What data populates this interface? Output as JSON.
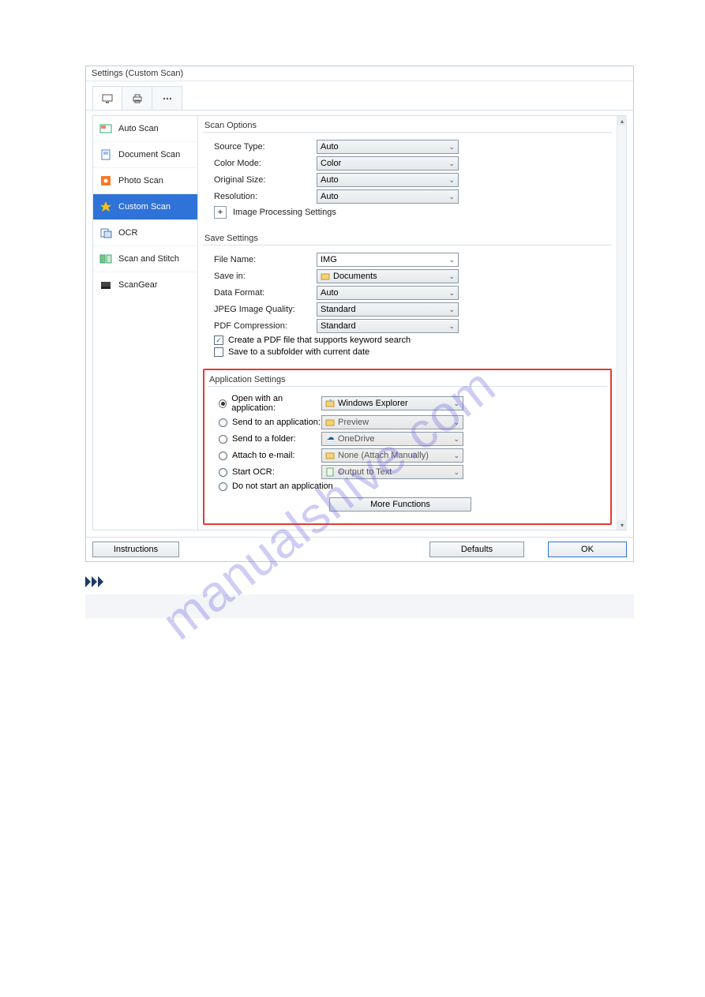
{
  "window": {
    "title": "Settings (Custom Scan)"
  },
  "sidebar": {
    "items": [
      {
        "label": "Auto Scan"
      },
      {
        "label": "Document Scan"
      },
      {
        "label": "Photo Scan"
      },
      {
        "label": "Custom Scan"
      },
      {
        "label": "OCR"
      },
      {
        "label": "Scan and Stitch"
      },
      {
        "label": "ScanGear"
      }
    ]
  },
  "scan_options": {
    "title": "Scan Options",
    "source_type": {
      "label": "Source Type:",
      "value": "Auto"
    },
    "color_mode": {
      "label": "Color Mode:",
      "value": "Color"
    },
    "original_size": {
      "label": "Original Size:",
      "value": "Auto"
    },
    "resolution": {
      "label": "Resolution:",
      "value": "Auto"
    },
    "img_proc": {
      "label": "Image Processing Settings",
      "plus": "+"
    }
  },
  "save_settings": {
    "title": "Save Settings",
    "file_name": {
      "label": "File Name:",
      "value": "IMG"
    },
    "save_in": {
      "label": "Save in:",
      "value": "Documents"
    },
    "data_format": {
      "label": "Data Format:",
      "value": "Auto"
    },
    "jpeg_quality": {
      "label": "JPEG Image Quality:",
      "value": "Standard"
    },
    "pdf_comp": {
      "label": "PDF Compression:",
      "value": "Standard"
    },
    "pdf_keyword": {
      "label": "Create a PDF file that supports keyword search",
      "checked": true
    },
    "subfolder": {
      "label": "Save to a subfolder with current date",
      "checked": false
    }
  },
  "app_settings": {
    "title": "Application Settings",
    "open_with": {
      "label": "Open with an application:",
      "value": "Windows Explorer"
    },
    "send_app": {
      "label": "Send to an application:",
      "value": "Preview"
    },
    "send_folder": {
      "label": "Send to a folder:",
      "value": "OneDrive"
    },
    "attach_mail": {
      "label": "Attach to e-mail:",
      "value": "None (Attach Manually)"
    },
    "start_ocr": {
      "label": "Start OCR:",
      "value": "Output to Text"
    },
    "no_start": {
      "label": "Do not start an application"
    },
    "more_functions": "More Functions"
  },
  "footer": {
    "instructions": "Instructions",
    "defaults": "Defaults",
    "ok": "OK"
  },
  "watermark": "manualshive.com"
}
